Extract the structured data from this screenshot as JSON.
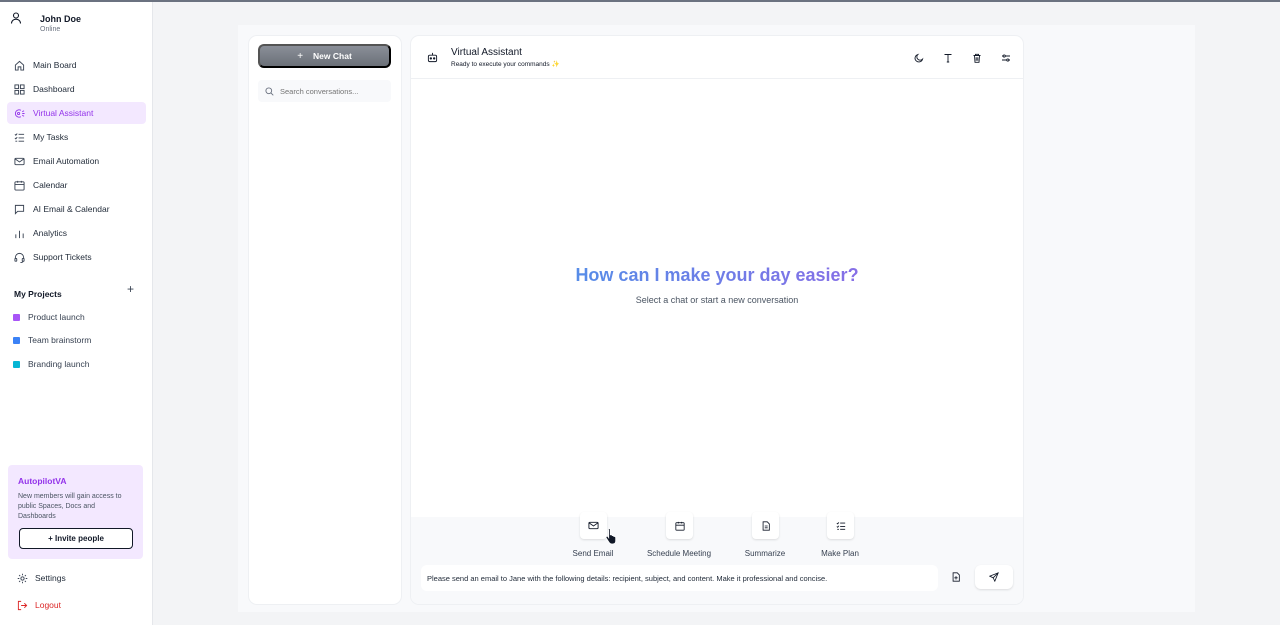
{
  "user": {
    "name": "John Doe",
    "status": "Online"
  },
  "nav": [
    {
      "label": "Main Board",
      "icon": "home-icon"
    },
    {
      "label": "Dashboard",
      "icon": "grid-icon"
    },
    {
      "label": "Virtual Assistant",
      "icon": "assistant-icon",
      "active": true
    },
    {
      "label": "My Tasks",
      "icon": "list-check-icon"
    },
    {
      "label": "Email Automation",
      "icon": "mail-icon"
    },
    {
      "label": "Calendar",
      "icon": "calendar-icon"
    },
    {
      "label": "AI Email & Calendar",
      "icon": "chat-bubble-icon"
    },
    {
      "label": "Analytics",
      "icon": "bar-chart-icon"
    },
    {
      "label": "Support Tickets",
      "icon": "headset-icon"
    }
  ],
  "projects": {
    "heading": "My Projects",
    "items": [
      {
        "label": "Product launch",
        "color": "#a855f7"
      },
      {
        "label": "Team brainstorm",
        "color": "#3b82f6"
      },
      {
        "label": "Branding launch",
        "color": "#06b6d4"
      }
    ]
  },
  "promo": {
    "title": "AutopilotVA",
    "text": "New members will gain access to public Spaces, Docs and Dashboards",
    "button": "+ Invite people"
  },
  "settings_label": "Settings",
  "logout_label": "Logout",
  "chats": {
    "new_chat_label": "New Chat",
    "search_placeholder": "Search conversations..."
  },
  "assistant": {
    "title": "Virtual Assistant",
    "subtitle": "Ready to execute your commands ✨",
    "hero_title": "How can I make your day easier?",
    "hero_subtitle": "Select a chat or start a new conversation",
    "actions": [
      {
        "label": "Send Email",
        "icon": "mail-icon"
      },
      {
        "label": "Schedule Meeting",
        "icon": "calendar-icon"
      },
      {
        "label": "Summarize",
        "icon": "document-icon"
      },
      {
        "label": "Make Plan",
        "icon": "list-check-icon"
      }
    ],
    "input_value": "Please send an email to Jane with the following details: recipient, subject, and content. Make it professional and concise."
  },
  "colors": {
    "accent": "#9333ea",
    "logout": "#dc2626",
    "hero_gradient_start": "#3b9ee8",
    "hero_gradient_end": "#a25de6"
  }
}
